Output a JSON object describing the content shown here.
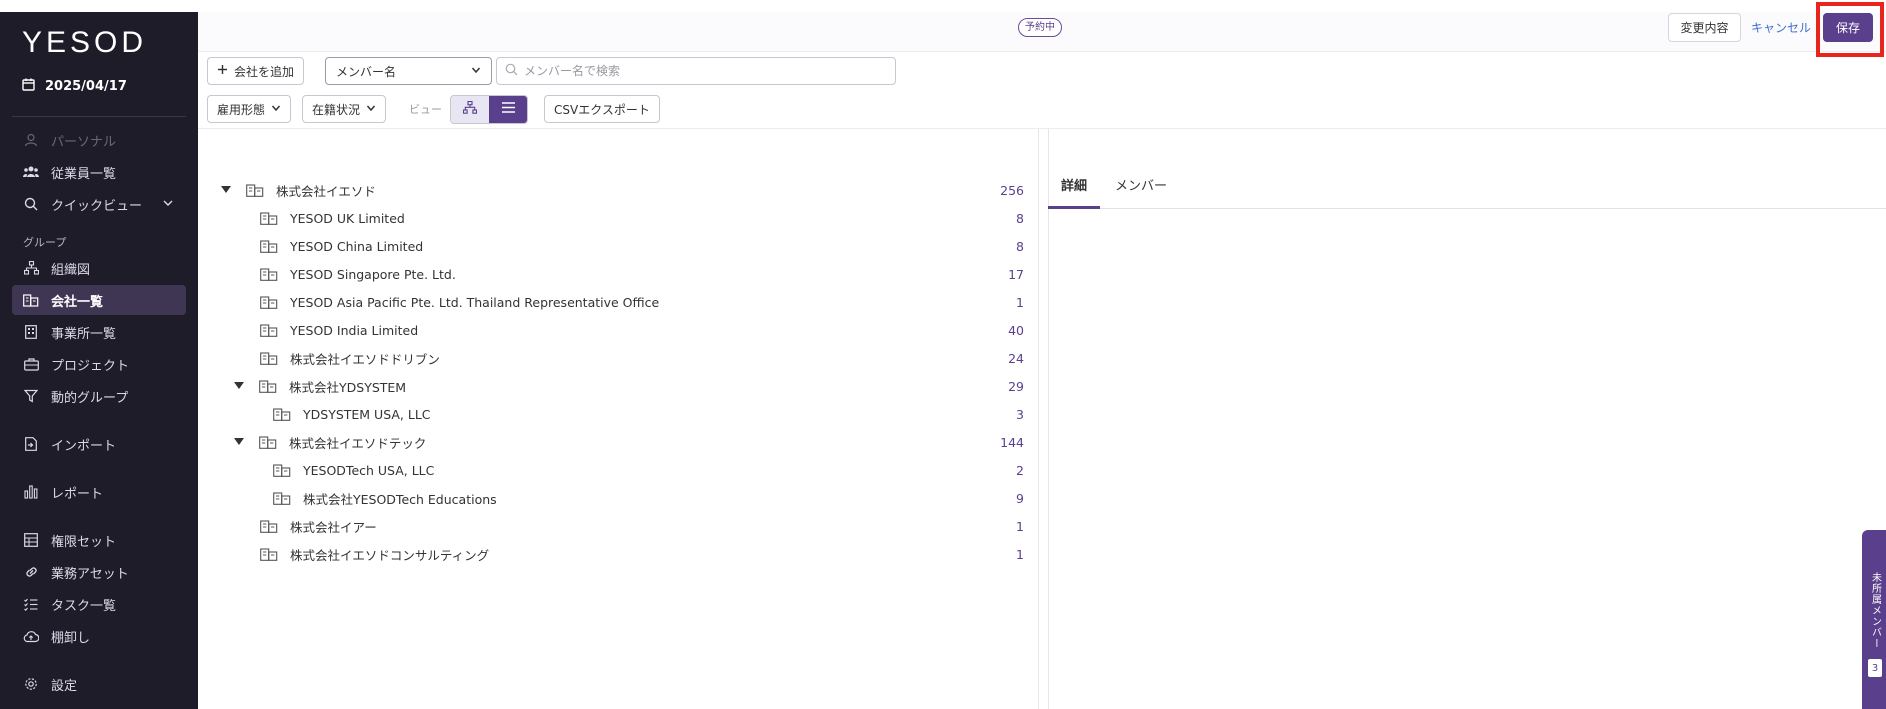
{
  "sidebar": {
    "logo": "YESOD",
    "date": "2025/04/17",
    "items": [
      {
        "label": "パーソナル"
      },
      {
        "label": "従業員一覧"
      },
      {
        "label": "クイックビュー"
      },
      {
        "label": "組織図"
      },
      {
        "label": "会社一覧"
      },
      {
        "label": "事業所一覧"
      },
      {
        "label": "プロジェクト"
      },
      {
        "label": "動的グループ"
      },
      {
        "label": "インポート"
      },
      {
        "label": "レポート"
      },
      {
        "label": "権限セット"
      },
      {
        "label": "業務アセット"
      },
      {
        "label": "タスク一覧"
      },
      {
        "label": "棚卸し"
      },
      {
        "label": "設定"
      }
    ],
    "group_heading": "グループ"
  },
  "topbar": {
    "status_badge": "予約中",
    "changes_label": "変更内容",
    "cancel_label": "キャンセル",
    "save_label": "保存"
  },
  "toolbar": {
    "add_company_label": "会社を追加",
    "member_select_value": "メンバー名",
    "search_placeholder": "メンバー名で検索",
    "employment_type_label": "雇用形態",
    "status_label": "在籍状況",
    "view_label": "ビュー",
    "csv_export_label": "CSVエクスポート"
  },
  "tree": [
    {
      "name": "株式会社イエソド",
      "count": "256"
    },
    {
      "name": "YESOD UK Limited",
      "count": "8"
    },
    {
      "name": "YESOD China Limited",
      "count": "8"
    },
    {
      "name": "YESOD Singapore Pte. Ltd.",
      "count": "17"
    },
    {
      "name": "YESOD Asia Pacific Pte. Ltd. Thailand Representative Office",
      "count": "1"
    },
    {
      "name": "YESOD India Limited",
      "count": "40"
    },
    {
      "name": "株式会社イエソドドリブン",
      "count": "24"
    },
    {
      "name": "株式会社YDSYSTEM",
      "count": "29"
    },
    {
      "name": "YDSYSTEM USA, LLC",
      "count": "3"
    },
    {
      "name": "株式会社イエソドテック",
      "count": "144"
    },
    {
      "name": "YESODTech USA, LLC",
      "count": "2"
    },
    {
      "name": "株式会社YESODTech Educations",
      "count": "9"
    },
    {
      "name": "株式会社イアー",
      "count": "1"
    },
    {
      "name": "株式会社イエソドコンサルティング",
      "count": "1"
    }
  ],
  "panel": {
    "tab_details": "詳細",
    "tab_members": "メンバー"
  },
  "side_tab": {
    "label": "未所属メンバー",
    "count": "3"
  },
  "colors": {
    "accent": "#5a3f8c",
    "sidebar_bg": "#1f1c2a",
    "highlight_frame": "#e8241d",
    "link": "#3f6fd1"
  }
}
